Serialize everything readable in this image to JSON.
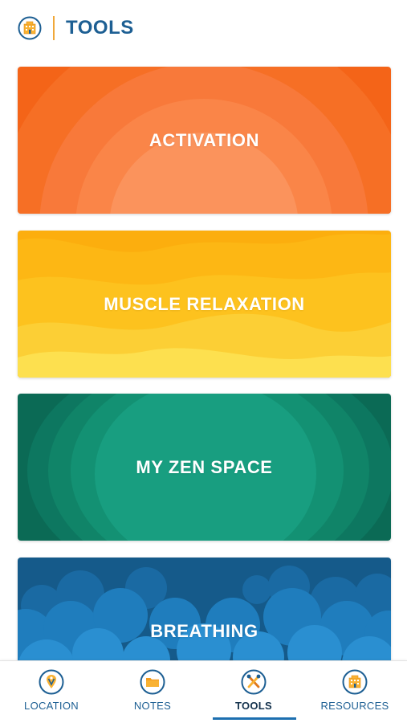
{
  "header": {
    "title": "TOOLS",
    "logo_icon": "building-icon"
  },
  "colors": {
    "brand_blue": "#1d5f93",
    "accent_orange": "#f0a83a",
    "activation": "#f26a21",
    "muscle_relaxation": "#fcb615",
    "zen": "#138b6e",
    "breathing": "#1e6ea8"
  },
  "cards": [
    {
      "label": "ACTIVATION"
    },
    {
      "label": "MUSCLE RELAXATION"
    },
    {
      "label": "MY ZEN SPACE"
    },
    {
      "label": "BREATHING"
    }
  ],
  "nav": {
    "active": "TOOLS",
    "items": [
      {
        "label": "LOCATION",
        "icon": "location-pin-icon"
      },
      {
        "label": "NOTES",
        "icon": "folder-icon"
      },
      {
        "label": "TOOLS",
        "icon": "tools-icon"
      },
      {
        "label": "RESOURCES",
        "icon": "building-icon"
      }
    ]
  }
}
